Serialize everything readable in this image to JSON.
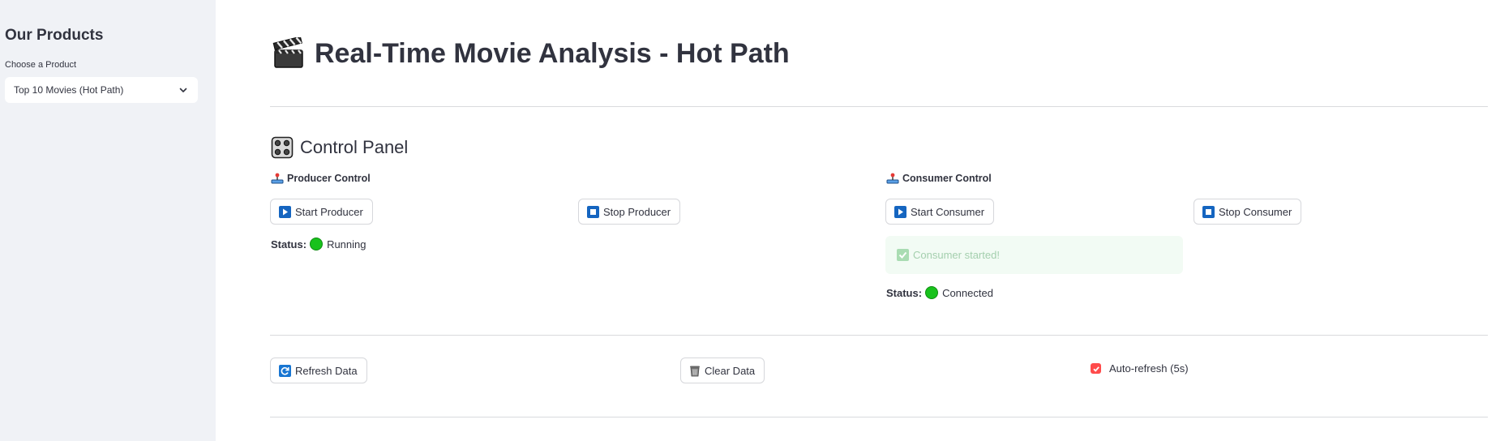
{
  "sidebar": {
    "title": "Our Products",
    "select_label": "Choose a Product",
    "selected_value": "Top 10 Movies (Hot Path)"
  },
  "main": {
    "title": "Real-Time Movie Analysis - Hot Path",
    "control_panel": {
      "heading": "Control Panel",
      "producer": {
        "heading": "Producer Control",
        "start_label": "Start Producer",
        "stop_label": "Stop Producer",
        "status_label": "Status:",
        "status_value": "Running"
      },
      "consumer": {
        "heading": "Consumer Control",
        "start_label": "Start Consumer",
        "stop_label": "Stop Consumer",
        "alert_text": "Consumer started!",
        "status_label": "Status:",
        "status_value": "Connected"
      }
    },
    "actions": {
      "refresh_label": "Refresh Data",
      "clear_label": "Clear Data",
      "auto_refresh_label": "Auto-refresh (5s)",
      "auto_refresh_checked": true
    }
  },
  "colors": {
    "sidebar_bg": "#f0f2f6",
    "text": "#31333f",
    "status_green": "#18c21c",
    "checkbox_red": "#ff4b4b",
    "button_icon_blue": "#1565c0",
    "success_bg": "#f2fbf4"
  },
  "icons": {
    "title": "clapper-board-icon",
    "control_panel": "control-knobs-icon",
    "producer": "joystick-icon",
    "consumer": "joystick-icon",
    "start": "play-button-icon",
    "stop": "stop-button-icon",
    "refresh": "refresh-icon",
    "clear": "wastebasket-icon",
    "alert": "check-mark-icon",
    "select": "chevron-down-icon"
  }
}
